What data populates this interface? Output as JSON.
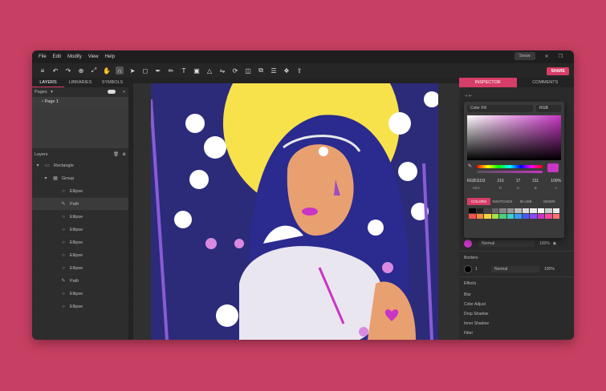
{
  "menu": [
    "File",
    "Edit",
    "Modify",
    "View",
    "Help"
  ],
  "doc_name": "Snow",
  "share_label": "SHARE",
  "left_tabs": [
    "LAYERS",
    "LIBRARIES",
    "SYMBOLS"
  ],
  "pages_label": "Pages",
  "page_item": "Page 1",
  "layers_label": "Layers",
  "layers": [
    {
      "name": "Rectangle",
      "indent": 0,
      "arrow": "▾",
      "icon": "▭"
    },
    {
      "name": "Group",
      "indent": 1,
      "arrow": "▾",
      "icon": "▦"
    },
    {
      "name": "Ellipse",
      "indent": 2,
      "arrow": "",
      "icon": "○"
    },
    {
      "name": "Path",
      "indent": 2,
      "arrow": "",
      "icon": "✎"
    },
    {
      "name": "Ellipse",
      "indent": 2,
      "arrow": "",
      "icon": "○"
    },
    {
      "name": "Ellipse",
      "indent": 2,
      "arrow": "",
      "icon": "○"
    },
    {
      "name": "Ellipse",
      "indent": 2,
      "arrow": "",
      "icon": "○"
    },
    {
      "name": "Ellipse",
      "indent": 2,
      "arrow": "",
      "icon": "○"
    },
    {
      "name": "Ellipse",
      "indent": 2,
      "arrow": "",
      "icon": "○"
    },
    {
      "name": "Path",
      "indent": 2,
      "arrow": "",
      "icon": "✎"
    },
    {
      "name": "Ellipse",
      "indent": 2,
      "arrow": "",
      "icon": "○"
    },
    {
      "name": "Ellipse",
      "indent": 2,
      "arrow": "",
      "icon": "○"
    }
  ],
  "right_tabs": [
    "INSPECTOR",
    "COMMENTS"
  ],
  "picker": {
    "fill_type": "Color Fill",
    "mode": "RGB",
    "hex": "#C935C5",
    "values": [
      "RGB11D3",
      "216",
      "17",
      "211",
      "100%"
    ],
    "value_labels": [
      "HEX",
      "R",
      "G",
      "B",
      "A"
    ],
    "tabs": [
      "COLORS",
      "SWATCHES",
      "IN USE",
      "MIXER"
    ],
    "swatches": [
      "#000",
      "#222",
      "#444",
      "#666",
      "#888",
      "#999",
      "#bbb",
      "#ddd",
      "#eee",
      "#fff",
      "#ccc",
      "#e8e8e8",
      "#f25050",
      "#f58a3a",
      "#f5d43a",
      "#a8e04a",
      "#4ad07a",
      "#3ad0c8",
      "#3a9af5",
      "#4a5af5",
      "#8a4af5",
      "#c935c5",
      "#f54a9a",
      "#ff6f6f"
    ]
  },
  "inspector": {
    "blend": "Normal",
    "opacity": "100%",
    "borders_label": "Borders",
    "border_width": "1",
    "border_blend": "Normal",
    "border_opacity": "100%",
    "effects_label": "Effects",
    "effects": [
      "Blur",
      "Color Adjust",
      "Drop Shadow",
      "Inner Shadow",
      "Filter"
    ]
  },
  "colors": {
    "accent": "#d63d67",
    "bg": "#c73f62",
    "fill": "#c935c5"
  }
}
